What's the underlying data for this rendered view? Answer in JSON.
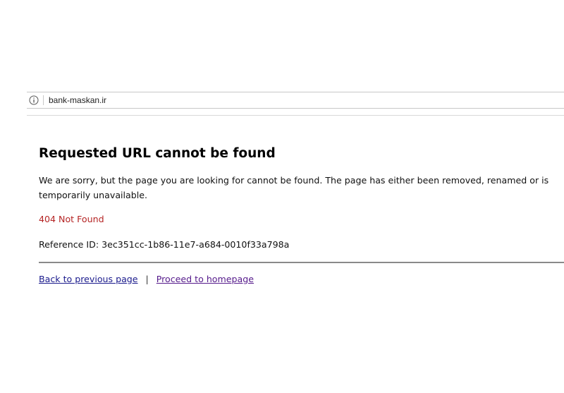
{
  "address_bar": {
    "url": "bank-maskan.ir",
    "icon": "info-icon"
  },
  "error": {
    "title": "Requested URL cannot be found",
    "description": "We are sorry, but the page you are looking for cannot be found. The page has either been removed, renamed or is temporarily unavailable.",
    "status": "404 Not Found",
    "reference": "Reference ID: 3ec351cc-1b86-11e7-a684-0010f33a798a"
  },
  "links": {
    "back": "Back to previous page",
    "separator": "|",
    "home": "Proceed to homepage"
  },
  "colors": {
    "status_red": "#b52424",
    "link_blue": "#1a1a8c",
    "link_visited": "#551a8b"
  }
}
